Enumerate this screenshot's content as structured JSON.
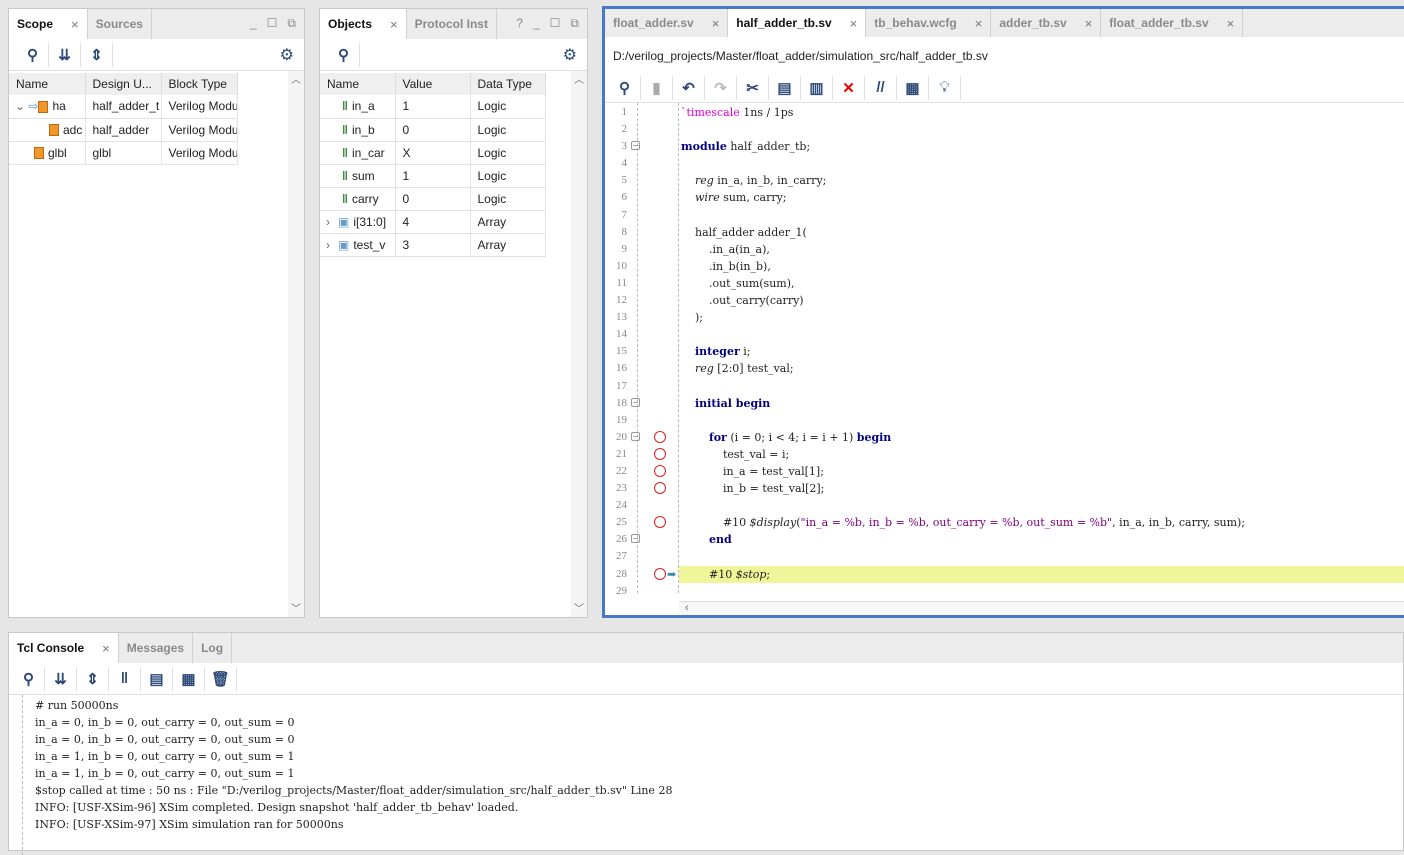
{
  "scope_panel": {
    "tabs": [
      "Scope",
      "Sources"
    ],
    "columns": [
      "Name",
      "Design U...",
      "Block Type"
    ],
    "rows": [
      {
        "name": "ha",
        "design": "half_adder_t",
        "block": "Verilog Modu",
        "expanded": true
      },
      {
        "name": "adc",
        "design": "half_adder",
        "block": "Verilog Modu"
      },
      {
        "name": "glbl",
        "design": "glbl",
        "block": "Verilog Modu"
      }
    ]
  },
  "objects_panel": {
    "tabs": [
      "Objects",
      "Protocol Inst"
    ],
    "help": "?",
    "columns": [
      "Name",
      "Value",
      "Data Type"
    ],
    "rows": [
      {
        "name": "in_a",
        "value": "1",
        "type": "Logic"
      },
      {
        "name": "in_b",
        "value": "0",
        "type": "Logic"
      },
      {
        "name": "in_car",
        "value": "X",
        "type": "Logic"
      },
      {
        "name": "sum",
        "value": "1",
        "type": "Logic"
      },
      {
        "name": "carry",
        "value": "0",
        "type": "Logic"
      },
      {
        "name": "i[31:0]",
        "value": "4",
        "type": "Array"
      },
      {
        "name": "test_v",
        "value": "3",
        "type": "Array"
      }
    ]
  },
  "editor": {
    "tabs": [
      "float_adder.sv",
      "half_adder_tb.sv",
      "tb_behav.wcfg",
      "adder_tb.sv",
      "float_adder_tb.sv"
    ],
    "active_tab": 1,
    "path": "D:/verilog_projects/Master/float_adder/simulation_src/half_adder_tb.sv",
    "current_line": 28,
    "breakpoints": [
      20,
      21,
      22,
      23,
      25,
      28
    ],
    "folds": [
      3,
      18,
      20,
      26
    ],
    "lines": [
      [
        [
          "`timescale",
          "dir"
        ],
        [
          " 1ns / 1ps",
          ""
        ]
      ],
      [],
      [
        [
          "module",
          "kw"
        ],
        [
          " half_adder_tb;",
          ""
        ]
      ],
      [],
      [
        [
          "    ",
          ""
        ],
        [
          "reg",
          "ty"
        ],
        [
          " in_a, in_b, in_carry;",
          ""
        ]
      ],
      [
        [
          "    ",
          ""
        ],
        [
          "wire",
          "ty"
        ],
        [
          " sum, carry;",
          ""
        ]
      ],
      [],
      [
        [
          "    half_adder adder_1(",
          ""
        ]
      ],
      [
        [
          "        .in_a(in_a),",
          ""
        ]
      ],
      [
        [
          "        .in_b(in_b),",
          ""
        ]
      ],
      [
        [
          "        .out_sum(sum),",
          ""
        ]
      ],
      [
        [
          "        .out_carry(carry)",
          ""
        ]
      ],
      [
        [
          "    );",
          ""
        ]
      ],
      [],
      [
        [
          "    ",
          ""
        ],
        [
          "integer",
          "kw"
        ],
        [
          " i;",
          ""
        ]
      ],
      [
        [
          "    ",
          ""
        ],
        [
          "reg",
          "ty"
        ],
        [
          " [2:0] test_val;",
          ""
        ]
      ],
      [],
      [
        [
          "    ",
          ""
        ],
        [
          "initial begin",
          "kw"
        ]
      ],
      [],
      [
        [
          "        ",
          ""
        ],
        [
          "for",
          "kw"
        ],
        [
          " (i = 0; i < 4; i = i + 1) ",
          ""
        ],
        [
          "begin",
          "kw"
        ]
      ],
      [
        [
          "            test_val = i;",
          ""
        ]
      ],
      [
        [
          "            in_a = test_val[1];",
          ""
        ]
      ],
      [
        [
          "            in_b = test_val[2];",
          ""
        ]
      ],
      [],
      [
        [
          "            #10 ",
          ""
        ],
        [
          "$display",
          "ty"
        ],
        [
          "(",
          ""
        ],
        [
          "\"in_a = %b, in_b = %b, out_carry = %b, out_sum = %b\"",
          "str"
        ],
        [
          ", in_a, in_b, carry, sum);",
          ""
        ]
      ],
      [
        [
          "        ",
          ""
        ],
        [
          "end",
          "kw"
        ]
      ],
      [],
      [
        [
          "        #10 ",
          ""
        ],
        [
          "$stop",
          "ty"
        ],
        [
          ";",
          ""
        ]
      ],
      []
    ]
  },
  "console": {
    "tabs": [
      "Tcl Console",
      "Messages",
      "Log"
    ],
    "lines": [
      "# run 50000ns",
      "in_a = 0, in_b = 0, out_carry = 0, out_sum = 0",
      "in_a = 0, in_b = 0, out_carry = 0, out_sum = 0",
      "in_a = 1, in_b = 0, out_carry = 0, out_sum = 1",
      "in_a = 1, in_b = 0, out_carry = 0, out_sum = 1",
      "$stop called at time : 50 ns : File \"D:/verilog_projects/Master/float_adder/simulation_src/half_adder_tb.sv\" Line 28",
      "INFO: [USF-XSim-96] XSim completed. Design snapshot 'half_adder_tb_behav' loaded.",
      "INFO: [USF-XSim-97] XSim simulation ran for 50000ns"
    ]
  },
  "colors": {
    "accent": "#4a78c8",
    "highlight": "#f0f59a",
    "breakpoint": "#e02020",
    "keyword": "#000080",
    "string": "#800080"
  }
}
